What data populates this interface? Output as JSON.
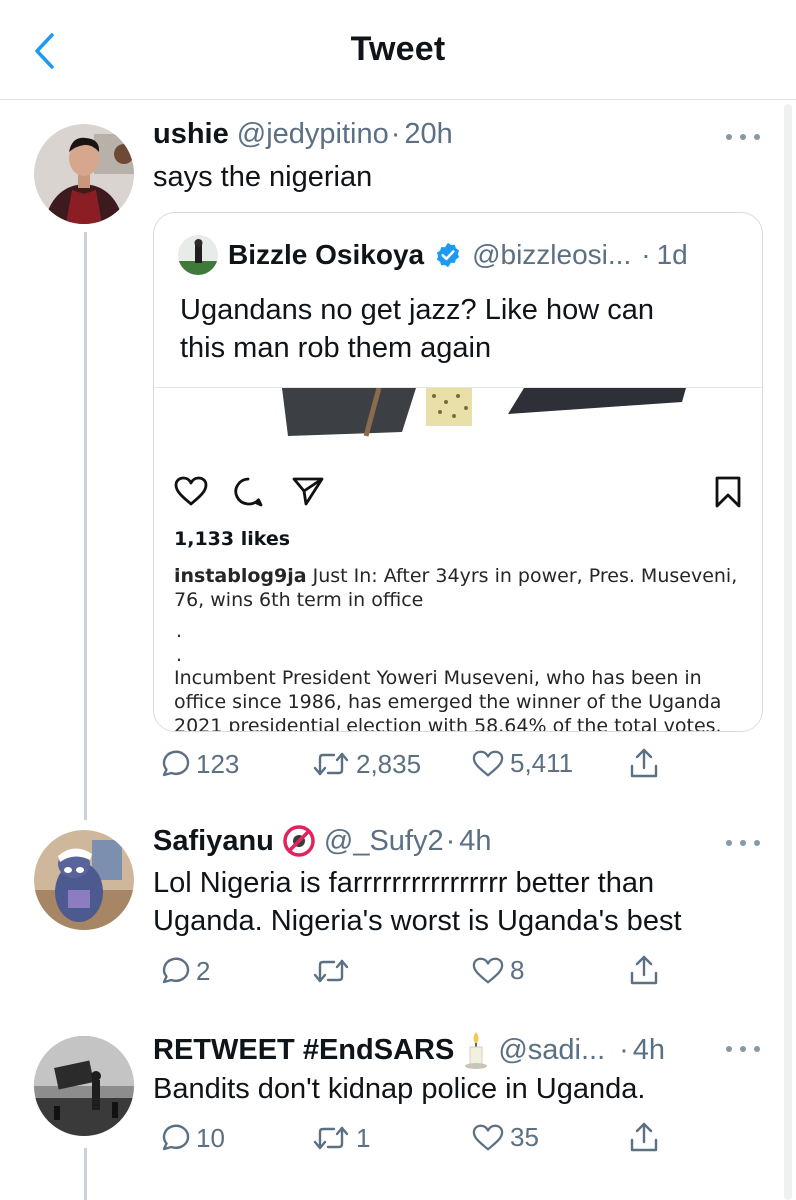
{
  "header": {
    "title": "Tweet"
  },
  "main_tweet": {
    "name": "ushie",
    "handle": "@jedypitino",
    "sep": "·",
    "time": "20h",
    "text": "says the nigerian",
    "quote": {
      "name": "Bizzle Osikoya",
      "handle": "@bizzleosi...",
      "sep": "·",
      "time": "1d",
      "text_line1": "Ugandans no get jazz? Like how can",
      "text_line2": "this man rob them again",
      "instagram": {
        "likes": "1,133 likes",
        "username": "instablog9ja",
        "caption": " Just In: After 34yrs in power, Pres. Museveni, 76, wins 6th term in office",
        "dot1": ".",
        "dot2": ".",
        "body": "Incumbent President Yoweri Museveni, who has been in office since 1986, has emerged the winner of the Uganda 2021 presidential election with 58.64% of the total votes."
      }
    },
    "replies": "123",
    "retweets": "2,835",
    "likes": "5,411"
  },
  "reply1": {
    "name": "Safiyanu",
    "handle": "@_Sufy2",
    "sep": "·",
    "time": "4h",
    "text_line1": "Lol Nigeria is farrrrrrrrrrrrrrrr better than",
    "text_line2": "Uganda. Nigeria's worst is Uganda's best",
    "replies": "2",
    "retweets": "",
    "likes": "8"
  },
  "reply2": {
    "name": "RETWEET #EndSARS",
    "handle": "@sadi...",
    "sep": "·",
    "time": "4h",
    "text": "Bandits don't kidnap police in Uganda.",
    "replies": "10",
    "retweets": "1",
    "likes": "35"
  },
  "colors": {
    "accent": "#1d9bf0",
    "secondary": "#5b7083",
    "verified": "#1d9bf0"
  }
}
